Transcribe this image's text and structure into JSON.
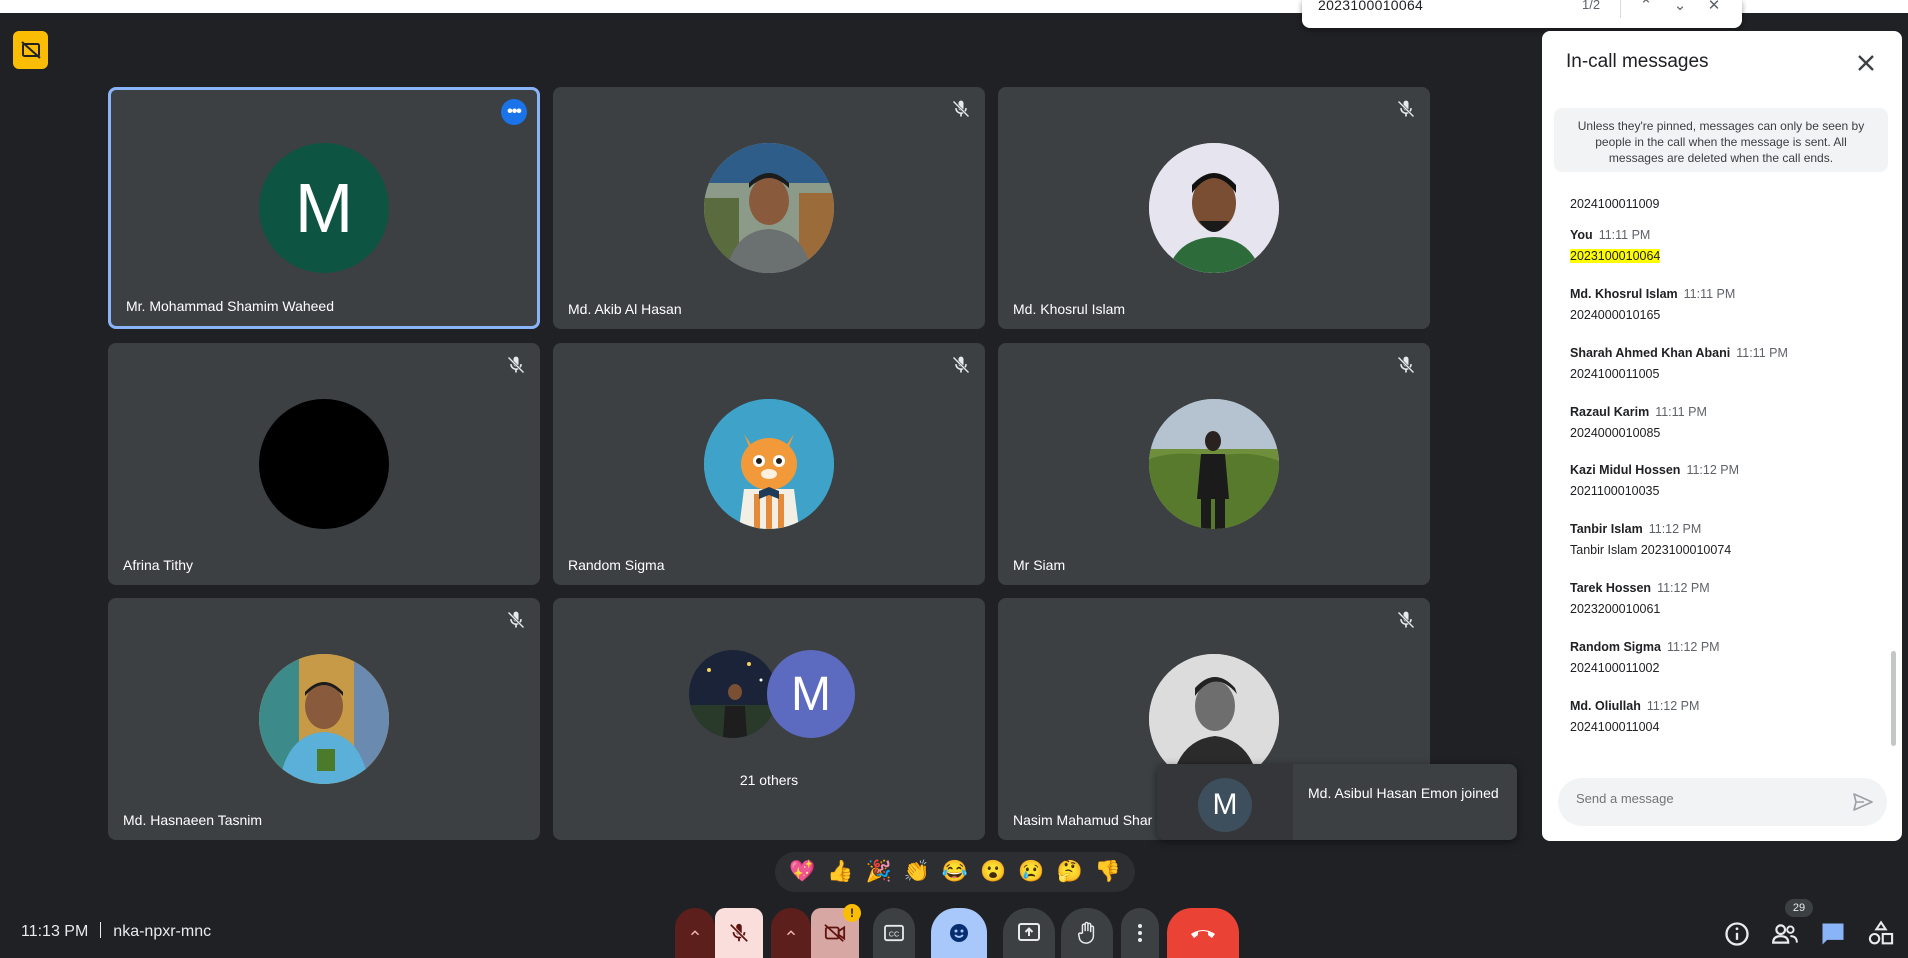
{
  "find_bar": {
    "query": "2023100010064",
    "count": "1/2"
  },
  "tiles": [
    {
      "name": "Mr. Mohammad Shamim Waheed",
      "letter": "M",
      "avatar_color": "#0d5443",
      "active": true
    },
    {
      "name": "Md. Akib Al Hasan"
    },
    {
      "name": "Md. Khosrul Islam"
    },
    {
      "name": "Afrina Tithy",
      "avatar_color": "#000000"
    },
    {
      "name": "Random Sigma"
    },
    {
      "name": "Mr Siam"
    },
    {
      "name": "Md. Hasnaeen Tasnim"
    },
    {
      "others_label": "21 others",
      "letter": "M",
      "avatar_color": "#5c6bc0"
    },
    {
      "name": "Nasim Mahamud Shar"
    }
  ],
  "toast": {
    "letter": "M",
    "text": "Md. Asibul Hasan Emon joined"
  },
  "panel": {
    "title": "In-call messages",
    "notice": "Unless they're pinned, messages can only be seen by people in the call when the message is sent. All messages are deleted when the call ends.",
    "messages": [
      {
        "sender": "",
        "time": "",
        "text": "2024100011009"
      },
      {
        "sender": "You",
        "time": "11:11 PM",
        "text": "2023100010064",
        "highlight": true
      },
      {
        "sender": "Md. Khosrul Islam",
        "time": "11:11 PM",
        "text": "2024000010165"
      },
      {
        "sender": "Sharah Ahmed Khan Abani",
        "time": "11:11 PM",
        "text": "2024100011005"
      },
      {
        "sender": "Razaul Karim",
        "time": "11:11 PM",
        "text": "2024000010085"
      },
      {
        "sender": "Kazi Midul Hossen",
        "time": "11:12 PM",
        "text": "2021100010035"
      },
      {
        "sender": "Tanbir Islam",
        "time": "11:12 PM",
        "text": "Tanbir Islam 2023100010074"
      },
      {
        "sender": "Tarek Hossen",
        "time": "11:12 PM",
        "text": "2023200010061"
      },
      {
        "sender": "Random Sigma",
        "time": "11:12 PM",
        "text": "2024100011002"
      },
      {
        "sender": "Md. Oliullah",
        "time": "11:12 PM",
        "text": "2024100011004"
      }
    ],
    "compose_placeholder": "Send a message"
  },
  "reactions": [
    "💖",
    "👍",
    "🎉",
    "👏",
    "😂",
    "😮",
    "😢",
    "🤔",
    "👎"
  ],
  "bottom": {
    "time": "11:13 PM",
    "meeting_code": "nka-npxr-mnc",
    "participant_count": "29"
  },
  "colors": {
    "accent": "#8ab4f8",
    "end_call": "#ea4335",
    "panel_bg": "#ffffff",
    "page_bg": "#202124",
    "highlight": "#ffff00"
  }
}
